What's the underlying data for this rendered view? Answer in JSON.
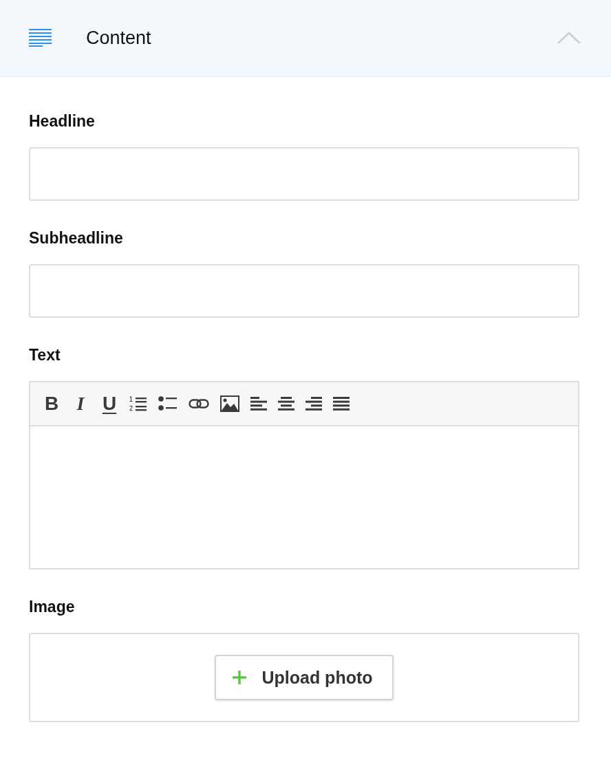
{
  "panel": {
    "title": "Content",
    "expanded": true
  },
  "fields": [
    {
      "kind": "input",
      "label": "Headline"
    },
    {
      "kind": "input",
      "label": "Subheadline"
    },
    {
      "kind": "editor",
      "label": "Text",
      "toolbar": [
        {
          "kind": "bold",
          "label": "B"
        },
        {
          "kind": "italic",
          "label": "I"
        },
        {
          "kind": "underline",
          "label": "U"
        },
        {
          "kind": "ordered-list"
        },
        {
          "kind": "bullet-list"
        },
        {
          "kind": "link"
        },
        {
          "kind": "image"
        },
        {
          "kind": "align-left"
        },
        {
          "kind": "align-center"
        },
        {
          "kind": "align-right"
        },
        {
          "kind": "justify"
        }
      ]
    },
    {
      "kind": "upload",
      "label": "Image",
      "button": "Upload photo"
    }
  ]
}
